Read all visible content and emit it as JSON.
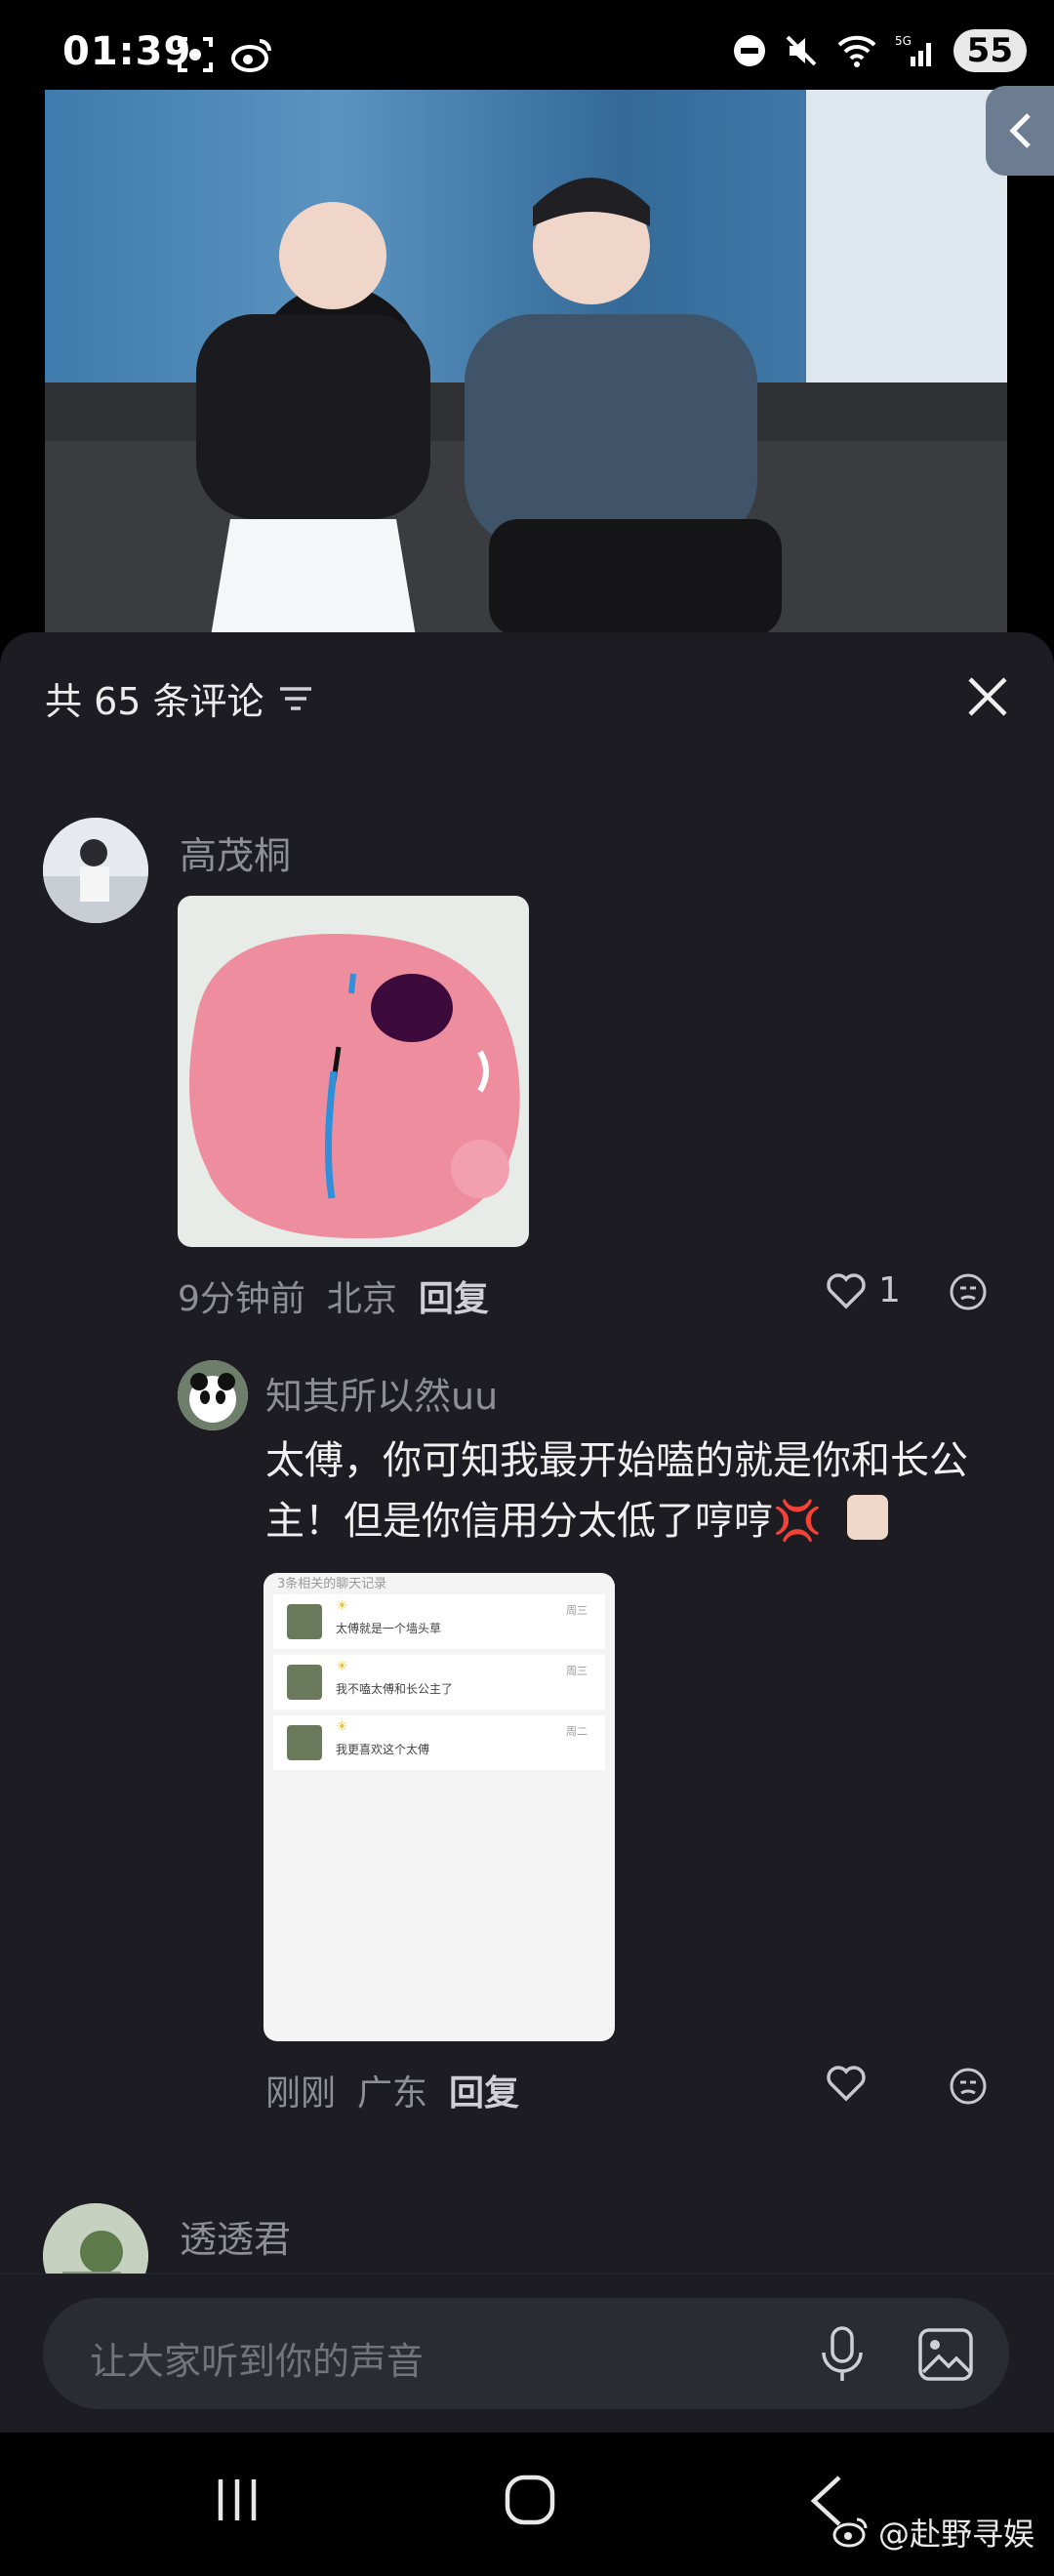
{
  "status_bar": {
    "time": "01:39",
    "battery": "55",
    "network": "5G"
  },
  "comments_panel": {
    "title": "共 65 条评论",
    "composer_placeholder": "让大家听到你的声音",
    "comments": [
      {
        "user": "高茂桐",
        "time": "9分钟前",
        "location": "北京",
        "reply_label": "回复",
        "likes": "1"
      },
      {
        "user": "知其所以然uu",
        "text_line1": "太傅，你可知我最开始嗑的就是你和长公",
        "text_line2": "主！但是你信用分太低了哼哼💢",
        "time": "刚刚",
        "location": "广东",
        "reply_label": "回复",
        "screenshot": {
          "header": "3条相关的聊天记录",
          "rows": [
            {
              "day": "周三",
              "text": "太傅就是一个墙头草"
            },
            {
              "day": "周三",
              "text": "我不嗑太傅和长公主了"
            },
            {
              "day": "周二",
              "text": "我更喜欢这个太傅"
            }
          ]
        }
      },
      {
        "user": "透透君"
      }
    ]
  },
  "watermark": "@赴野寻娱",
  "icons": [
    "sort-icon",
    "close-icon",
    "heart-icon",
    "emoji-icon",
    "mic-icon",
    "image-icon",
    "nav-recents-icon",
    "nav-home-icon",
    "nav-back-icon",
    "weibo-icon"
  ]
}
